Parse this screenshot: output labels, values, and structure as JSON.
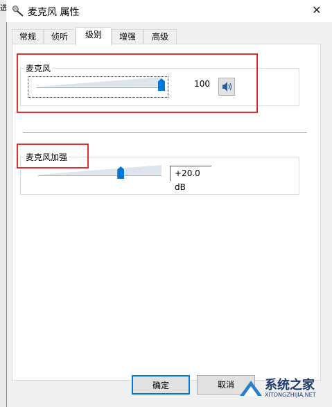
{
  "background_window": {
    "edge_text": "选"
  },
  "window": {
    "title": "麦克风 属性",
    "close_glyph": "✕"
  },
  "tabs": [
    {
      "label": "常规",
      "active": false
    },
    {
      "label": "侦听",
      "active": false
    },
    {
      "label": "级别",
      "active": true
    },
    {
      "label": "增强",
      "active": false
    },
    {
      "label": "高级",
      "active": false
    }
  ],
  "microphone": {
    "label": "麦克风",
    "value_text": "100",
    "level": 100,
    "speaker_icon": "speaker-icon"
  },
  "boost": {
    "label": "麦克风加强",
    "value_text": "+20.0 dB",
    "level_fraction": 0.67
  },
  "buttons": {
    "ok": "确定",
    "cancel": "取消"
  },
  "watermark": {
    "text": "系统之家",
    "sub": "XITONGZHIJIA.NET"
  },
  "colors": {
    "accent": "#0078d7",
    "highlight": "#e0302d"
  }
}
